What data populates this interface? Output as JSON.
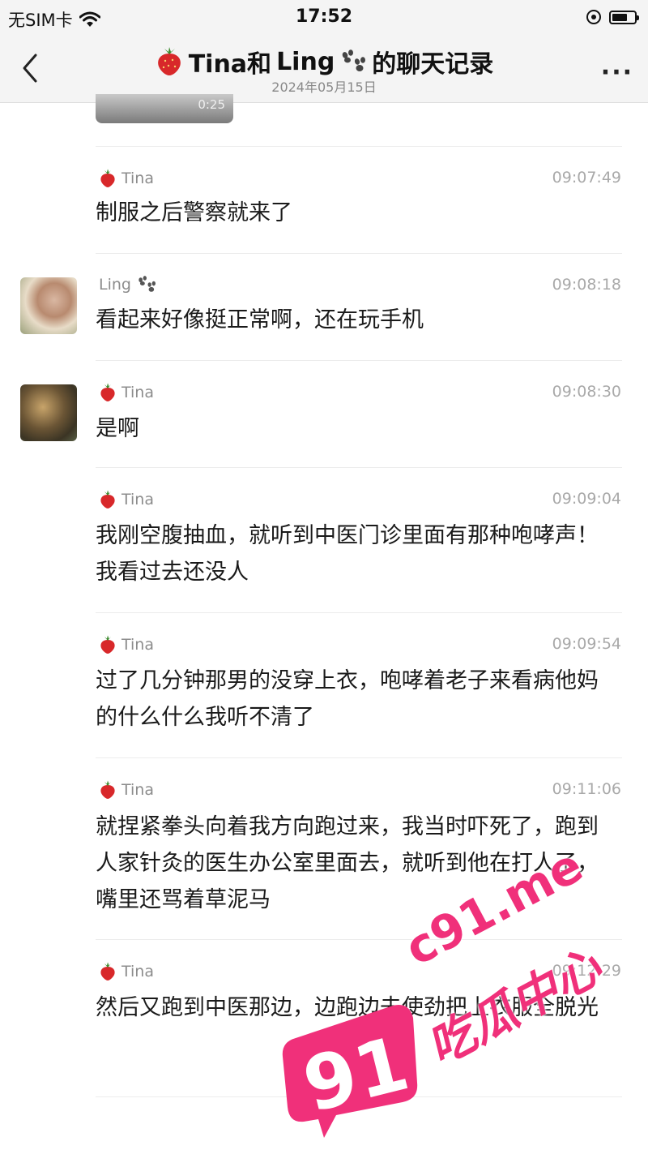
{
  "status_bar": {
    "carrier": "无SIM卡",
    "time": "17:52"
  },
  "nav": {
    "title_part1": "Tina和",
    "title_part2": "Ling",
    "title_part3": "的聊天记录",
    "date": "2024年05月15日",
    "more": "···"
  },
  "media": {
    "duration": "0:25"
  },
  "messages": [
    {
      "sender": "Tina",
      "time": "09:07:49",
      "text": "制服之后警察就来了"
    },
    {
      "sender": "Ling",
      "time": "09:08:18",
      "text": "看起来好像挺正常啊，还在玩手机"
    },
    {
      "sender": "Tina",
      "time": "09:08:30",
      "text": "是啊"
    },
    {
      "sender": "Tina",
      "time": "09:09:04",
      "text": "我刚空腹抽血，就听到中医门诊里面有那种咆哮声！我看过去还没人"
    },
    {
      "sender": "Tina",
      "time": "09:09:54",
      "text": "过了几分钟那男的没穿上衣，咆哮着老子来看病他妈的什么什么我听不清了"
    },
    {
      "sender": "Tina",
      "time": "09:11:06",
      "text": "就捏紧拳头向着我方向跑过来，我当时吓死了，跑到人家针灸的医生办公室里面去，就听到他在打人了，嘴里还骂着草泥马"
    },
    {
      "sender": "Tina",
      "time": "09:12:29",
      "text": "然后又跑到中医那边，边跑边去使劲把上衣服全脱光"
    }
  ],
  "watermark": {
    "site": "c91.me",
    "number": "91",
    "name": "吃瓜中心"
  },
  "colors": {
    "accent_pink": "#f0307a",
    "strawberry_red": "#d8282a"
  }
}
